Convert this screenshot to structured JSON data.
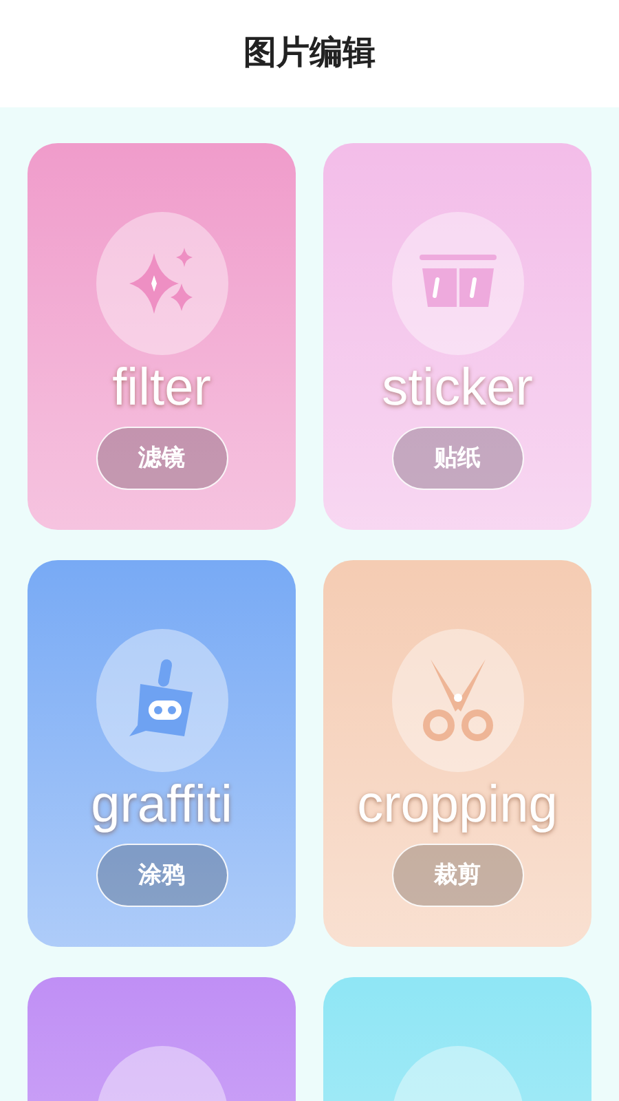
{
  "header": {
    "title": "图片编辑"
  },
  "cards": [
    {
      "kind": "filter",
      "color": "#f09ccb",
      "word": "filter",
      "label": "滤镜"
    },
    {
      "kind": "sticker",
      "color": "#f3bde9",
      "word": "sticker",
      "label": "贴纸"
    },
    {
      "kind": "graffiti",
      "color": "#78aaf5",
      "word": "graffiti",
      "label": "涂鸦"
    },
    {
      "kind": "cropping",
      "color": "#f5ccb3",
      "word": "cropping",
      "label": "裁剪"
    },
    {
      "kind": "other",
      "color": "#c08ff5"
    },
    {
      "kind": "other",
      "color": "#8fe6f5"
    }
  ]
}
